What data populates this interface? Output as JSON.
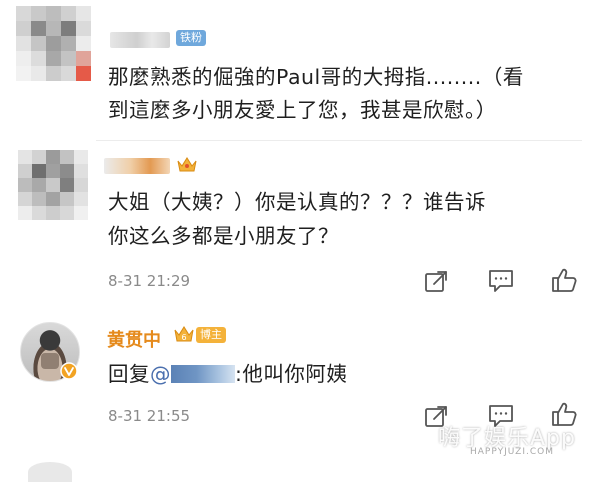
{
  "comments": [
    {
      "badge": "铁粉",
      "text_line1": "那麼熟悉的倔強的Paul哥的大拇指........（看",
      "text_line2": "到這麼多小朋友愛上了您，我甚是欣慰。）"
    },
    {
      "text_line1": "大姐（大姨？）你是认真的？？？谁告诉",
      "text_line2": "你这么多都是小朋友了？",
      "time": "8-31 21:29"
    },
    {
      "username": "黄贯中",
      "badge_level": "6",
      "badge": "博主",
      "reply_prefix": "回复",
      "mention_at": "@",
      "reply_suffix": ":他叫你阿姨",
      "time": "8-31 21:55"
    }
  ],
  "watermark": {
    "text": "嗨了娱乐App",
    "sub": "HAPPYJUZI.COM"
  },
  "colors": {
    "accent_username": "#e58a1c",
    "link": "#4a6fae",
    "time": "#8a8a8a"
  },
  "icons": [
    "share-icon",
    "comment-icon",
    "like-icon",
    "crown-icon",
    "verified-v-icon"
  ]
}
